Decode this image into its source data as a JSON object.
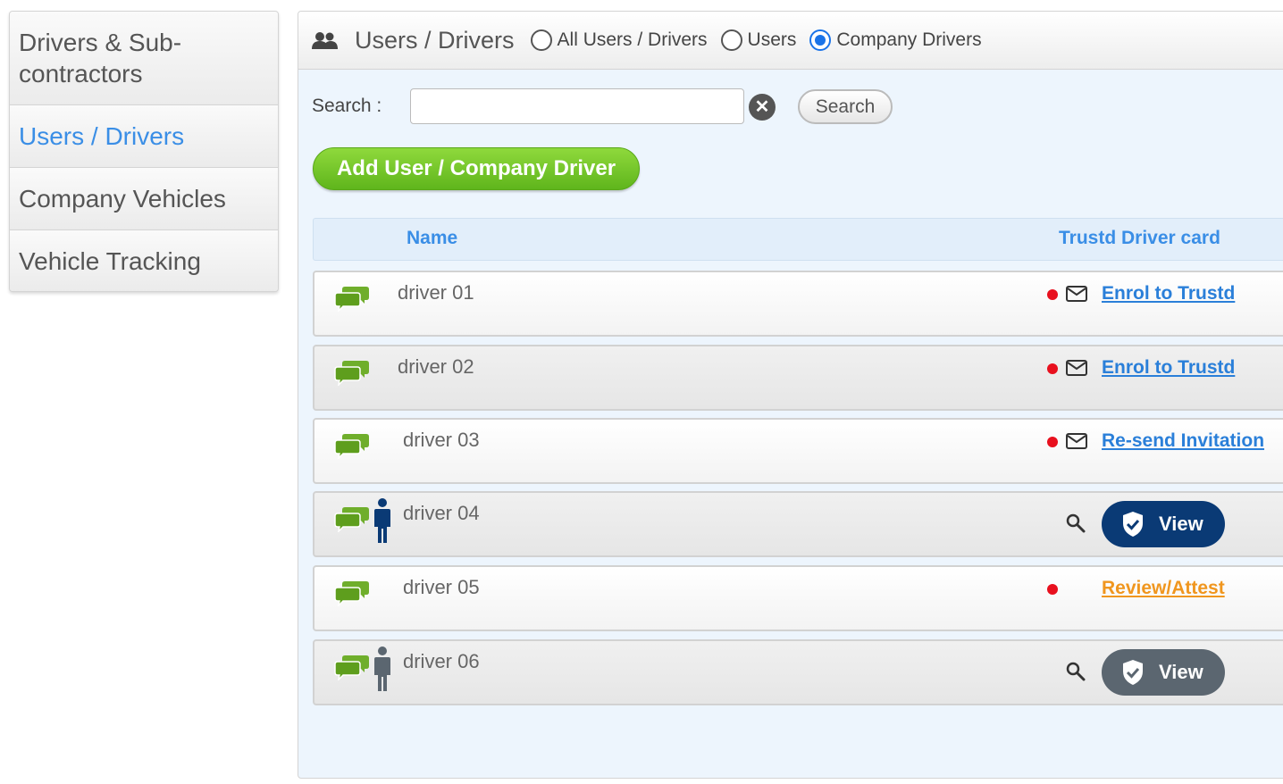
{
  "sidebar": {
    "items": [
      {
        "label": "Drivers & Sub-contractors"
      },
      {
        "label": "Users / Drivers"
      },
      {
        "label": "Company Vehicles"
      },
      {
        "label": "Vehicle Tracking"
      }
    ]
  },
  "header": {
    "icon": "users-icon",
    "title": "Users / Drivers",
    "filters": [
      {
        "label": "All Users / Drivers",
        "checked": false
      },
      {
        "label": "Users",
        "checked": false
      },
      {
        "label": "Company Drivers",
        "checked": true
      }
    ]
  },
  "search": {
    "label": "Search :",
    "value": "",
    "placeholder": "",
    "button_label": "Search",
    "clear_icon": "clear-icon"
  },
  "add_button_label": "Add User / Company Driver",
  "table": {
    "headers": {
      "name": "Name",
      "card": "Trustd Driver card"
    },
    "rows": [
      {
        "name": "driver 01",
        "status_dot": true,
        "mail": true,
        "action": "Enrol to Trustd",
        "person": null
      },
      {
        "name": "driver 02",
        "status_dot": true,
        "mail": true,
        "action": "Enrol to Trustd",
        "person": null
      },
      {
        "name": "driver 03",
        "status_dot": true,
        "mail": true,
        "action": "Re-send Invitation",
        "person": null
      },
      {
        "name": "driver 04",
        "status_dot": false,
        "mail": false,
        "action": "View",
        "person": "navy"
      },
      {
        "name": "driver 05",
        "status_dot": true,
        "mail": false,
        "action": "Review/Attest",
        "person": null
      },
      {
        "name": "driver 06",
        "status_dot": false,
        "mail": false,
        "action": "View",
        "person": "grey"
      }
    ]
  },
  "colors": {
    "accent_blue": "#3a8ee6",
    "green_button": "#6cc224",
    "status_red": "#e8101e",
    "review_orange": "#f0961e",
    "view_navy": "#0a3a75",
    "view_grey": "#5b6670"
  }
}
